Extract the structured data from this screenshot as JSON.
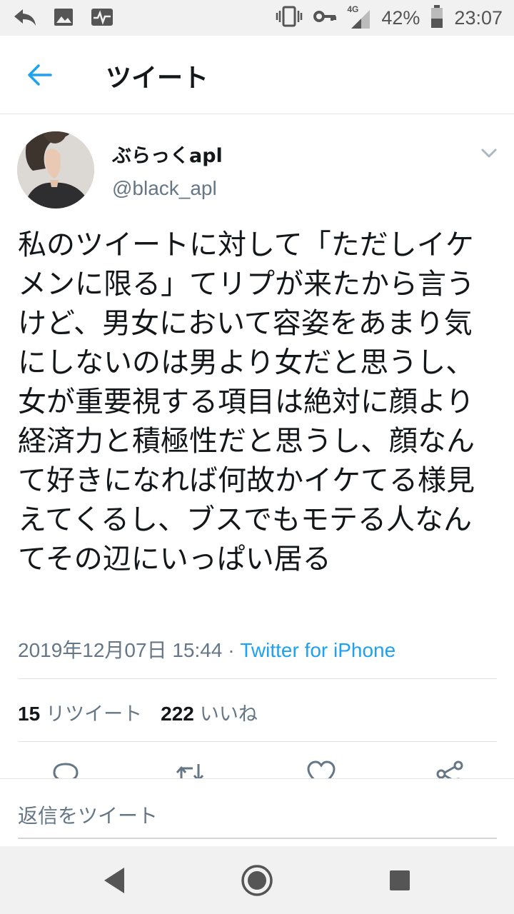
{
  "status_bar": {
    "network": "4G",
    "battery": "42%",
    "time": "23:07",
    "left_icons": [
      "reply-arrow-icon",
      "image-icon",
      "activity-icon"
    ],
    "right_icons": [
      "vibrate-icon",
      "key-icon",
      "signal-icon",
      "battery-icon"
    ]
  },
  "header": {
    "title": "ツイート",
    "back_icon": "back-arrow-icon"
  },
  "tweet": {
    "author_name": "ぶらっくapl",
    "author_handle": "@black_apl",
    "text": "私のツイートに対して「ただしイケメンに限る」てリプが来たから言うけど、男女において容姿をあまり気にしないのは男より女だと思うし、女が重要視する項目は絶対に顔より経済力と積極性だと思うし、顔なんて好きになれば何故かイケてる様見えてくるし、ブスでもモテる人なんてその辺にいっぱい居る",
    "timestamp": "2019年12月07日 15:44",
    "separator": " · ",
    "source": "Twitter for iPhone"
  },
  "stats": {
    "retweet_count": "15",
    "retweet_label": "リツイート",
    "like_count": "222",
    "like_label": "いいね"
  },
  "actions": [
    "reply-icon",
    "retweet-icon",
    "like-icon",
    "share-icon"
  ],
  "reply": {
    "placeholder": "返信をツイート"
  },
  "colors": {
    "accent": "#1da1f2",
    "secondary_text": "#657786",
    "primary_text": "#14171a"
  }
}
